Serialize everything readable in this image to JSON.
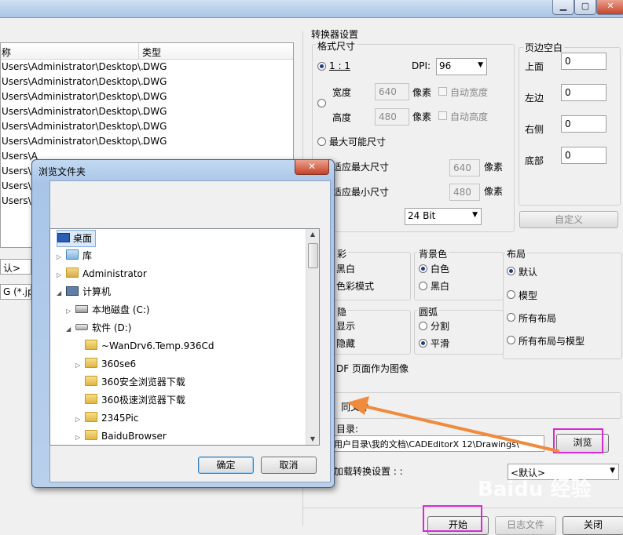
{
  "list": {
    "col_name": "称",
    "col_type": "类型",
    "rows": [
      {
        "name": "Users\\Administrator\\Desktop\\...",
        "type": "DWG"
      },
      {
        "name": "Users\\Administrator\\Desktop\\...",
        "type": "DWG"
      },
      {
        "name": "Users\\Administrator\\Desktop\\...",
        "type": "DWG"
      },
      {
        "name": "Users\\Administrator\\Desktop\\...",
        "type": "DWG"
      },
      {
        "name": "Users\\Administrator\\Desktop\\...",
        "type": "DWG"
      },
      {
        "name": "Users\\Administrator\\Desktop\\...",
        "type": "DWG"
      },
      {
        "name": "Users\\A",
        "type": ""
      },
      {
        "name": "Users\\A",
        "type": ""
      },
      {
        "name": "Users\\A",
        "type": ""
      },
      {
        "name": "Users\\A",
        "type": ""
      }
    ]
  },
  "left_combo1": "认>",
  "left_combo2": "G (*.jpg,",
  "converter": {
    "title": "转换器设置",
    "format_size": "格式尺寸",
    "ratio": "1 : 1",
    "dpi_label": "DPI:",
    "dpi_value": "96",
    "width_label": "宽度",
    "width_value": "640",
    "height_label": "高度",
    "height_value": "480",
    "pixels": "像素",
    "auto_width": "自动宽度",
    "auto_height": "自动高度",
    "max_size": "最大可能尺寸",
    "fit_max": "适应最大尺寸",
    "fit_max_value": "640",
    "fit_min": "适应最小尺寸",
    "fit_min_value": "480",
    "color_depth": "24 Bit"
  },
  "margins": {
    "title": "页边空白",
    "top": "上面",
    "top_value": "0",
    "left": "左边",
    "left_value": "0",
    "right": "右侧",
    "right_value": "0",
    "bottom": "底部",
    "bottom_value": "0",
    "custom_button": "自定义"
  },
  "color_group": {
    "title": "彩",
    "bw": "黑白",
    "color_mode": "色彩模式"
  },
  "background": {
    "title": "背景色",
    "white": "白色",
    "black": "黑白"
  },
  "layout": {
    "title": "布局",
    "default": "默认",
    "model": "模型",
    "all_layouts": "所有布局",
    "all_layouts_model": "所有布局与模型"
  },
  "hidden_group": {
    "title": "隐",
    "show": "显示",
    "hide": "隐藏"
  },
  "arc": {
    "title": "圆弧",
    "split": "分割",
    "smooth": "平滑"
  },
  "pdf_option": "DF 页面作为图像",
  "same_folder": "同文件",
  "output": {
    "label": "目录:",
    "path": "用户目录\\我的文档\\CADEditorX 12\\Drawings\\",
    "browse": "浏览"
  },
  "load_settings": {
    "label": "加载转换设置 : :",
    "value": "<默认>"
  },
  "footer": {
    "start": "开始",
    "log": "日志文件",
    "close": "关闭"
  },
  "browse_dialog": {
    "title": "浏览文件夹",
    "close_glyph": "✕",
    "tree": [
      {
        "label": "桌面"
      },
      {
        "label": "库"
      },
      {
        "label": "Administrator"
      },
      {
        "label": "计算机"
      },
      {
        "label": "本地磁盘 (C:)"
      },
      {
        "label": "软件 (D:)"
      },
      {
        "label": "~WanDrv6.Temp.936Cd"
      },
      {
        "label": "360se6"
      },
      {
        "label": "360安全浏览器下载"
      },
      {
        "label": "360极速浏览器下载"
      },
      {
        "label": "2345Pic"
      },
      {
        "label": "BaiduBrowser"
      }
    ],
    "ok": "确定",
    "cancel": "取消"
  },
  "watermark": "Baidu 经验",
  "colors": {
    "highlight": "#d62ad6",
    "arrow": "#f08a3c"
  }
}
